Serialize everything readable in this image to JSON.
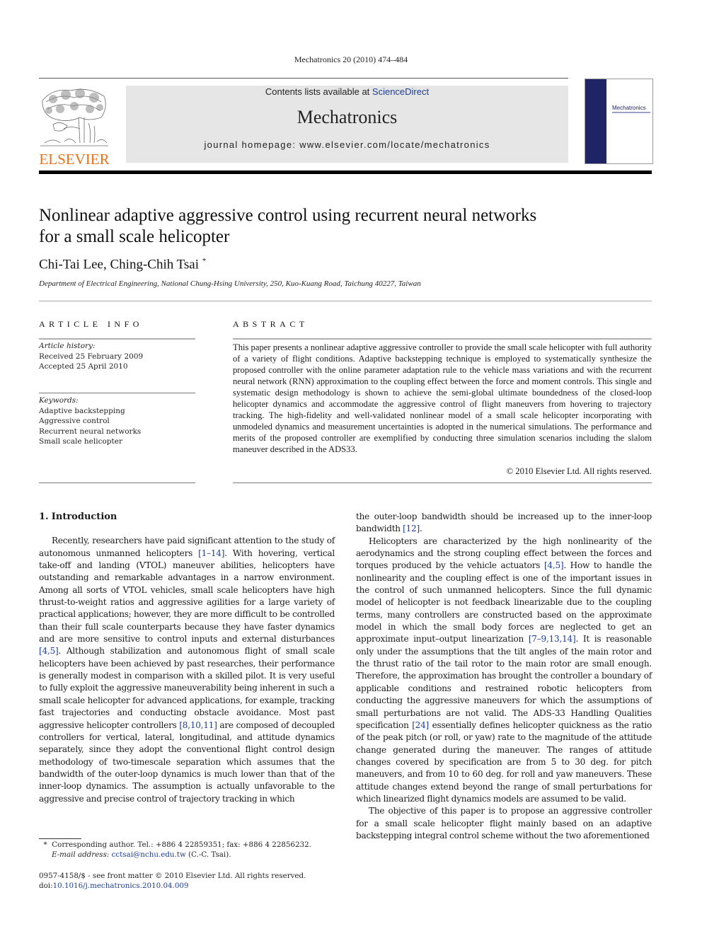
{
  "journal_citation": "Mechatronics 20 (2010) 474–484",
  "header": {
    "publisher_logo_text": "ELSEVIER",
    "contents_prefix": "Contents lists available at ",
    "contents_link": "ScienceDirect",
    "journal_title": "Mechatronics",
    "homepage": "journal homepage: www.elsevier.com/locate/mechatronics",
    "cover_title": "Mechatronics",
    "colors": {
      "publisher_orange": "#e9711c",
      "link_blue": "#1e3c96",
      "banner_gray": "#e6e6e6",
      "cover_navy": "#1f2466"
    }
  },
  "article": {
    "title_line1": "Nonlinear adaptive aggressive control using recurrent neural networks",
    "title_line2": "for a small scale helicopter",
    "authors": "Chi-Tai Lee, Ching-Chih Tsai",
    "corresponding_mark": "*",
    "affiliation": "Department of Electrical Engineering, National Chung-Hsing University, 250, Kuo-Kuang Road, Taichung 40227, Taiwan"
  },
  "article_info": {
    "heading": "ARTICLE INFO",
    "history_label": "Article history:",
    "received": "Received 25 February 2009",
    "accepted": "Accepted 25 April 2010",
    "keywords_label": "Keywords:",
    "keywords": [
      "Adaptive backstepping",
      "Aggressive control",
      "Recurrent neural networks",
      "Small scale helicopter"
    ]
  },
  "abstract": {
    "heading": "ABSTRACT",
    "text": "This paper presents a nonlinear adaptive aggressive controller to provide the small scale helicopter with full authority of a variety of flight conditions. Adaptive backstepping technique is employed to systematically synthesize the proposed controller with the online parameter adaptation rule to the vehicle mass variations and with the recurrent neural network (RNN) approximation to the coupling effect between the force and moment controls. This single and systematic design methodology is shown to achieve the semi-global ultimate boundedness of the closed-loop helicopter dynamics and accommodate the aggressive control of flight maneuvers from hovering to trajectory tracking. The high-fidelity and well-validated nonlinear model of a small scale helicopter incorporating with unmodeled dynamics and measurement uncertainties is adopted in the numerical simulations. The performance and merits of the proposed controller are exemplified by conducting three simulation scenarios including the slalom maneuver described in the ADS33.",
    "copyright": "© 2010 Elsevier Ltd. All rights reserved."
  },
  "body": {
    "section_heading": "1. Introduction",
    "left": {
      "p1_a": "Recently, researchers have paid significant attention to the study of autonomous unmanned helicopters ",
      "p1_ref1": "[1–14]",
      "p1_b": ". With hovering, vertical take-off and landing (VTOL) maneuver abilities, helicopters have outstanding and remarkable advantages in a narrow environment. Among all sorts of VTOL vehicles, small scale helicopters have high thrust-to-weight ratios and aggressive agilities for a large variety of practical applications; however, they are more difficult to be controlled than their full scale counterparts because they have faster dynamics and are more sensitive to control inputs and external disturbances ",
      "p1_ref2": "[4,5]",
      "p1_c": ". Although stabilization and autonomous flight of small scale helicopters have been achieved by past researches, their performance is generally modest in comparison with a skilled pilot. It is very useful to fully exploit the aggressive maneuverability being inherent in such a small scale helicopter for advanced applications, for example, tracking fast trajectories and conducting obstacle avoidance. Most past aggressive helicopter controllers ",
      "p1_ref3": "[8,10,11]",
      "p1_d": " are composed of decoupled controllers for vertical, lateral, longitudinal, and attitude dynamics separately, since they adopt the conventional flight control design methodology of two-timescale separation which assumes that the bandwidth of the outer-loop dynamics is much lower than that of the inner-loop dynamics. The assumption is actually unfavorable to the aggressive and precise control of trajectory tracking in which"
    },
    "right": {
      "p0_a": "the outer-loop bandwidth should be increased up to the inner-loop bandwidth ",
      "p0_ref": "[12]",
      "p0_b": ".",
      "p2_a": "Helicopters are characterized by the high nonlinearity of the aerodynamics and the strong coupling effect between the forces and torques produced by the vehicle actuators ",
      "p2_ref1": "[4,5]",
      "p2_b": ". How to handle the nonlinearity and the coupling effect is one of the important issues in the control of such unmanned helicopters. Since the full dynamic model of helicopter is not feedback linearizable due to the coupling terms, many controllers are constructed based on the approximate model in which the small body forces are neglected to get an approximate input–output linearization ",
      "p2_ref2": "[7–9,13,14]",
      "p2_c": ". It is reasonable only under the assumptions that the tilt angles of the main rotor and the thrust ratio of the tail rotor to the main rotor are small enough. Therefore, the approximation has brought the controller a boundary of applicable conditions and restrained robotic helicopters from conducting the aggressive maneuvers for which the assumptions of small perturbations are not valid. The ADS-33 Handling Qualities specification ",
      "p2_ref3": "[24]",
      "p2_d": " essentially defines helicopter quickness as the ratio of the peak pitch (or roll, or yaw) rate to the magnitude of the attitude change generated during the maneuver. The ranges of attitude changes covered by specification are from 5 to 30 deg. for pitch maneuvers, and from 10 to 60 deg. for roll and yaw maneuvers. These attitude changes extend beyond the range of small perturbations for which linearized flight dynamics models are assumed to be valid.",
      "p3": "The objective of this paper is to propose an aggressive controller for a small scale helicopter flight mainly based on an adaptive backstepping integral control scheme without the two aforementioned"
    }
  },
  "footnote": {
    "mark": "*",
    "corresponding": "Corresponding author. Tel.: +886 4 22859351; fax: +886 4 22856232.",
    "email_label": "E-mail address: ",
    "email": "cctsai@nchu.edu.tw",
    "email_suffix": " (C.-C. Tsai)."
  },
  "front_matter": {
    "issn_line": "0957-4158/$ - see front matter © 2010 Elsevier Ltd. All rights reserved.",
    "doi_label": "doi:",
    "doi": "10.1016/j.mechatronics.2010.04.009"
  }
}
